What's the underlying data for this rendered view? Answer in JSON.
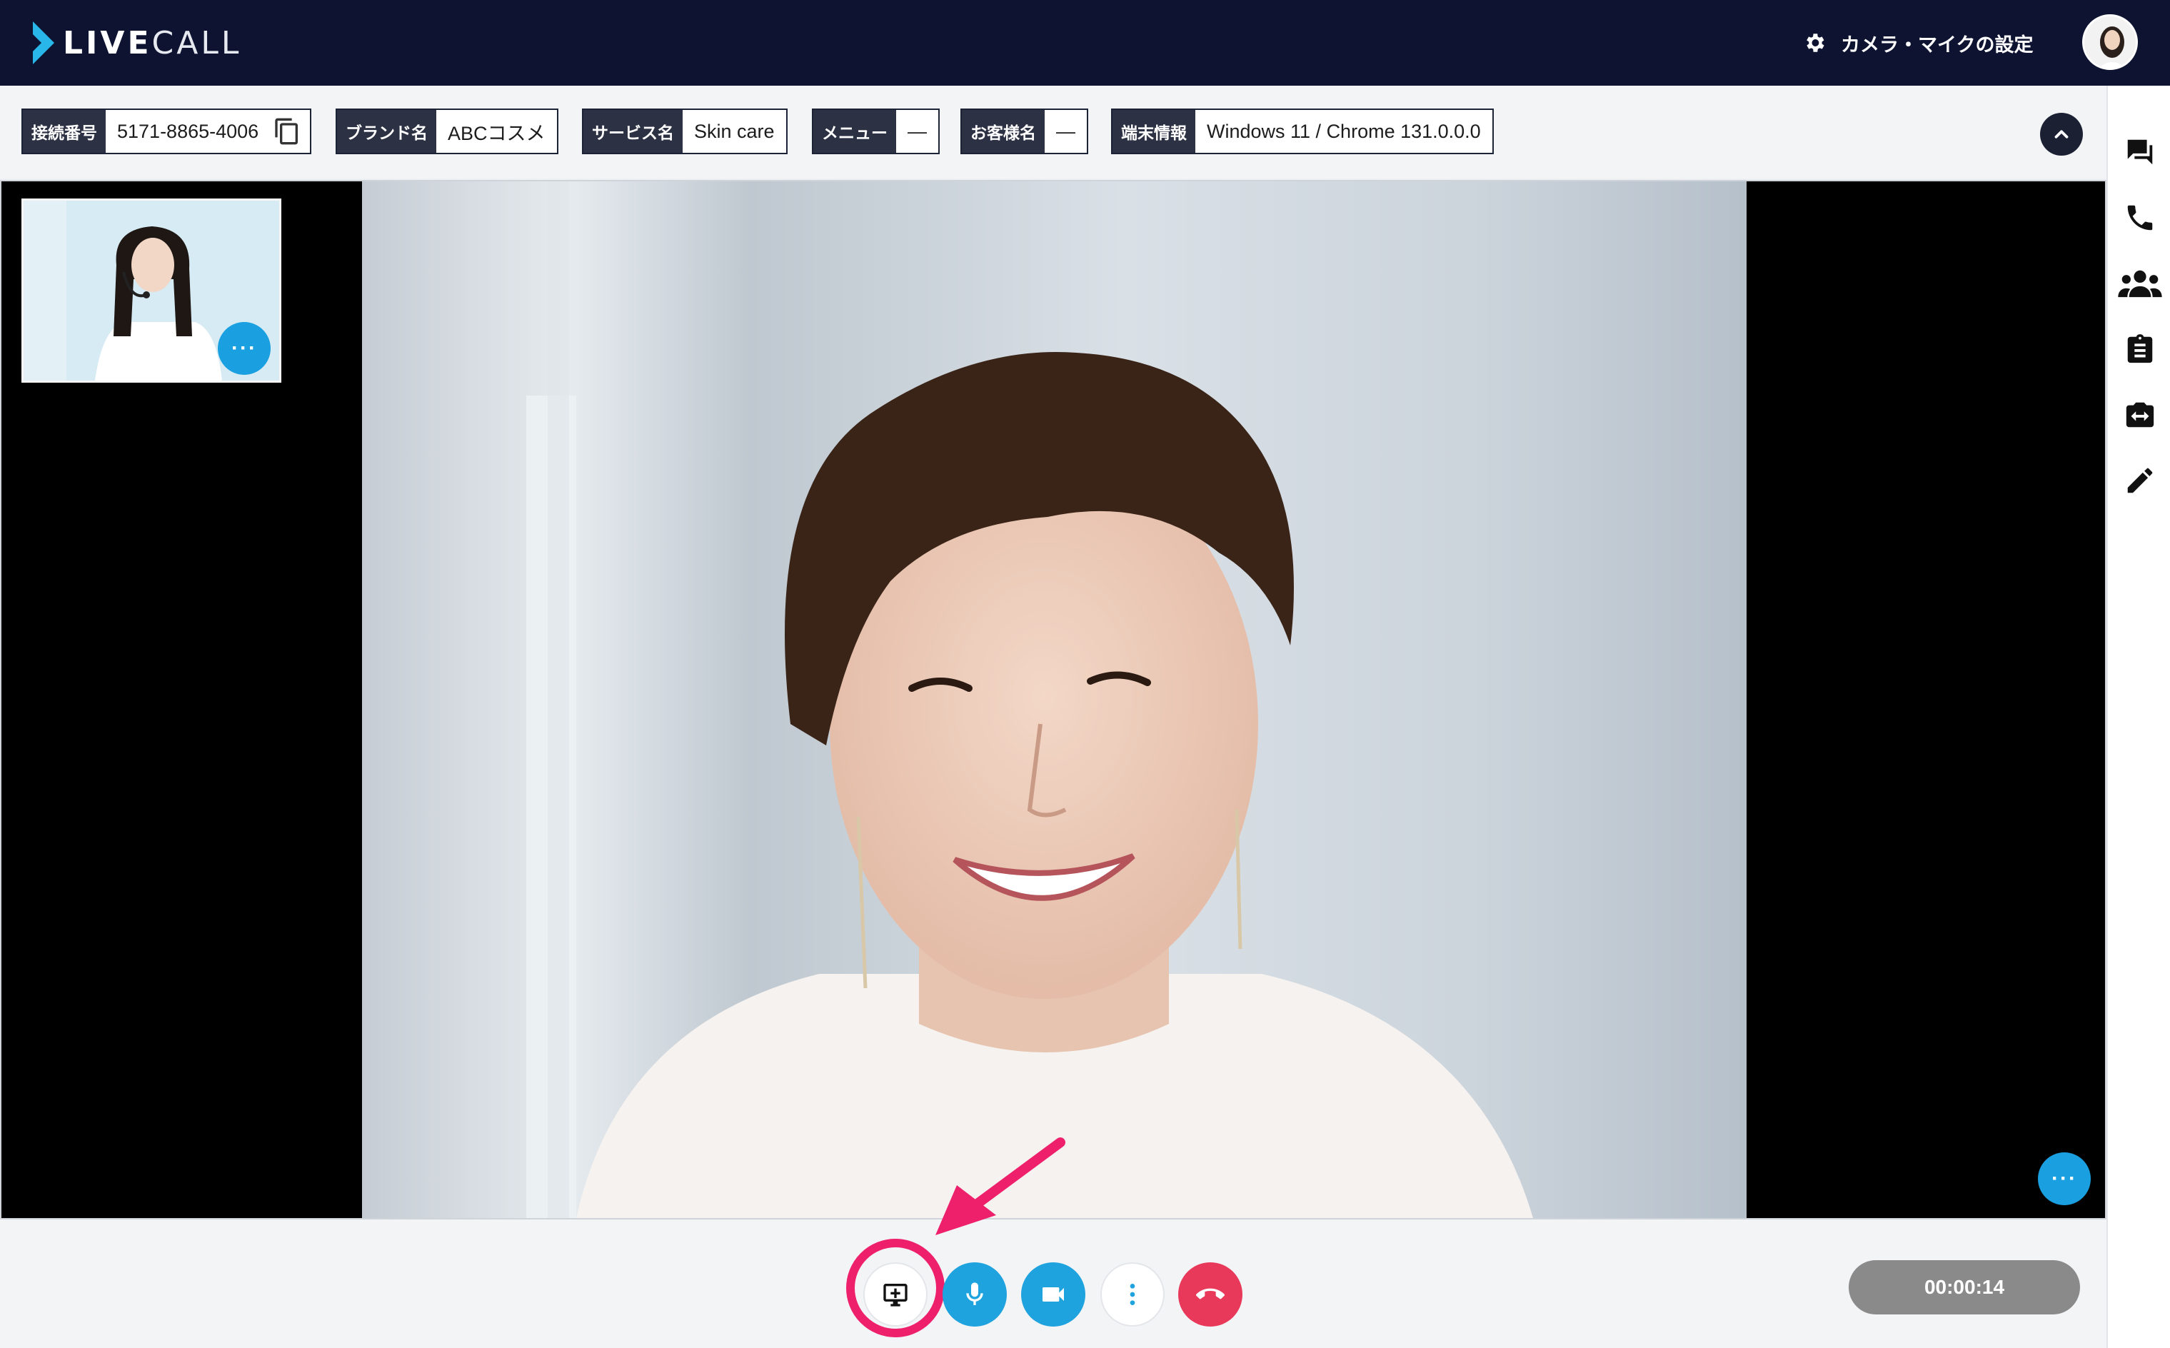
{
  "app": {
    "logo_text_bold": "LIVE",
    "logo_text_light": "CALL",
    "settings_label": "カメラ・マイクの設定"
  },
  "info": {
    "connection_label": "接続番号",
    "connection_value": "5171-8865-4006",
    "brand_label": "ブランド名",
    "brand_value": "ABCコスメ",
    "service_label": "サービス名",
    "service_value": "Skin care",
    "menu_label": "メニュー",
    "menu_value": "—",
    "customer_label": "お客様名",
    "customer_value": "—",
    "device_label": "端末情報",
    "device_value": "Windows 11 / Chrome 131.0.0.0"
  },
  "video": {
    "thumb_menu": "···",
    "main_menu": "···"
  },
  "call": {
    "timer": "00:00:14"
  },
  "colors": {
    "header_bg": "#0d1330",
    "accent_blue": "#1aa0e0",
    "end_call": "#e8395a",
    "highlight": "#ee1f6b"
  },
  "icons": {
    "sidebar": [
      "chat-icon",
      "phone-icon",
      "group-icon",
      "clipboard-icon",
      "camera-switch-icon",
      "pencil-icon"
    ],
    "controls": [
      "screen-share-icon",
      "microphone-icon",
      "video-camera-icon",
      "more-vertical-icon",
      "hang-up-icon"
    ]
  }
}
